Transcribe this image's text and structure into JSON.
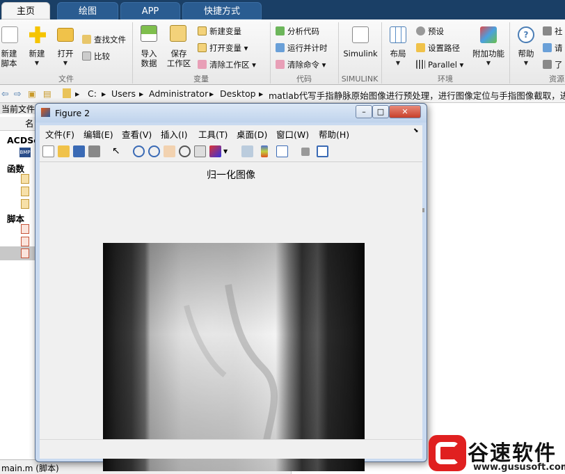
{
  "tabs": {
    "home": "主页",
    "plots": "绘图",
    "apps": "APP",
    "shortcuts": "快捷方式"
  },
  "ribbon": {
    "new_script": [
      "新建",
      "脚本"
    ],
    "new": "新建",
    "open": "打开",
    "find_files": "查找文件",
    "compare": "比较",
    "import": [
      "导入",
      "数据"
    ],
    "save_ws": [
      "保存",
      "工作区"
    ],
    "new_var": "新建变量",
    "open_var": "打开变量 ▾",
    "clear_ws": "清除工作区 ▾",
    "analyze": "分析代码",
    "run_time": "运行并计时",
    "clear_cmd": "清除命令 ▾",
    "simulink": "Simulink",
    "layout": "布局",
    "prefs": "预设",
    "set_path": "设置路径",
    "parallel": "Parallel ▾",
    "addons": "附加功能",
    "help": "帮助",
    "community": "社",
    "request": "请",
    "learn": "了",
    "groups": {
      "file": "文件",
      "variable": "变量",
      "code": "代码",
      "simulink": "SIMULINK",
      "env": "环境",
      "resources": "资源"
    }
  },
  "address": {
    "parts": [
      "C:",
      "Users",
      "Administrator",
      "Desktop",
      "matlab代写手指静脉原始图像进行预处理，进行图像定位与手指图像截取，进行"
    ]
  },
  "left": {
    "current_folder": "当前文件",
    "name_col": "名",
    "acd": "ACDSe",
    "functions": "函数",
    "scripts": "脚本",
    "bmp": "BMP"
  },
  "bottom": {
    "file": "main.m  (脚本)"
  },
  "figure": {
    "title": "Figure 2",
    "menus": [
      "文件(F)",
      "编辑(E)",
      "查看(V)",
      "插入(I)",
      "工具(T)",
      "桌面(D)",
      "窗口(W)",
      "帮助(H)"
    ],
    "axes_title": "归一化图像"
  },
  "watermark": {
    "cn": "谷速软件",
    "url": "www.gususoft.com",
    "color": "#e02020"
  },
  "colors": {
    "tabbar": "#1a3f66",
    "fig_frame": "#c9daf0"
  }
}
